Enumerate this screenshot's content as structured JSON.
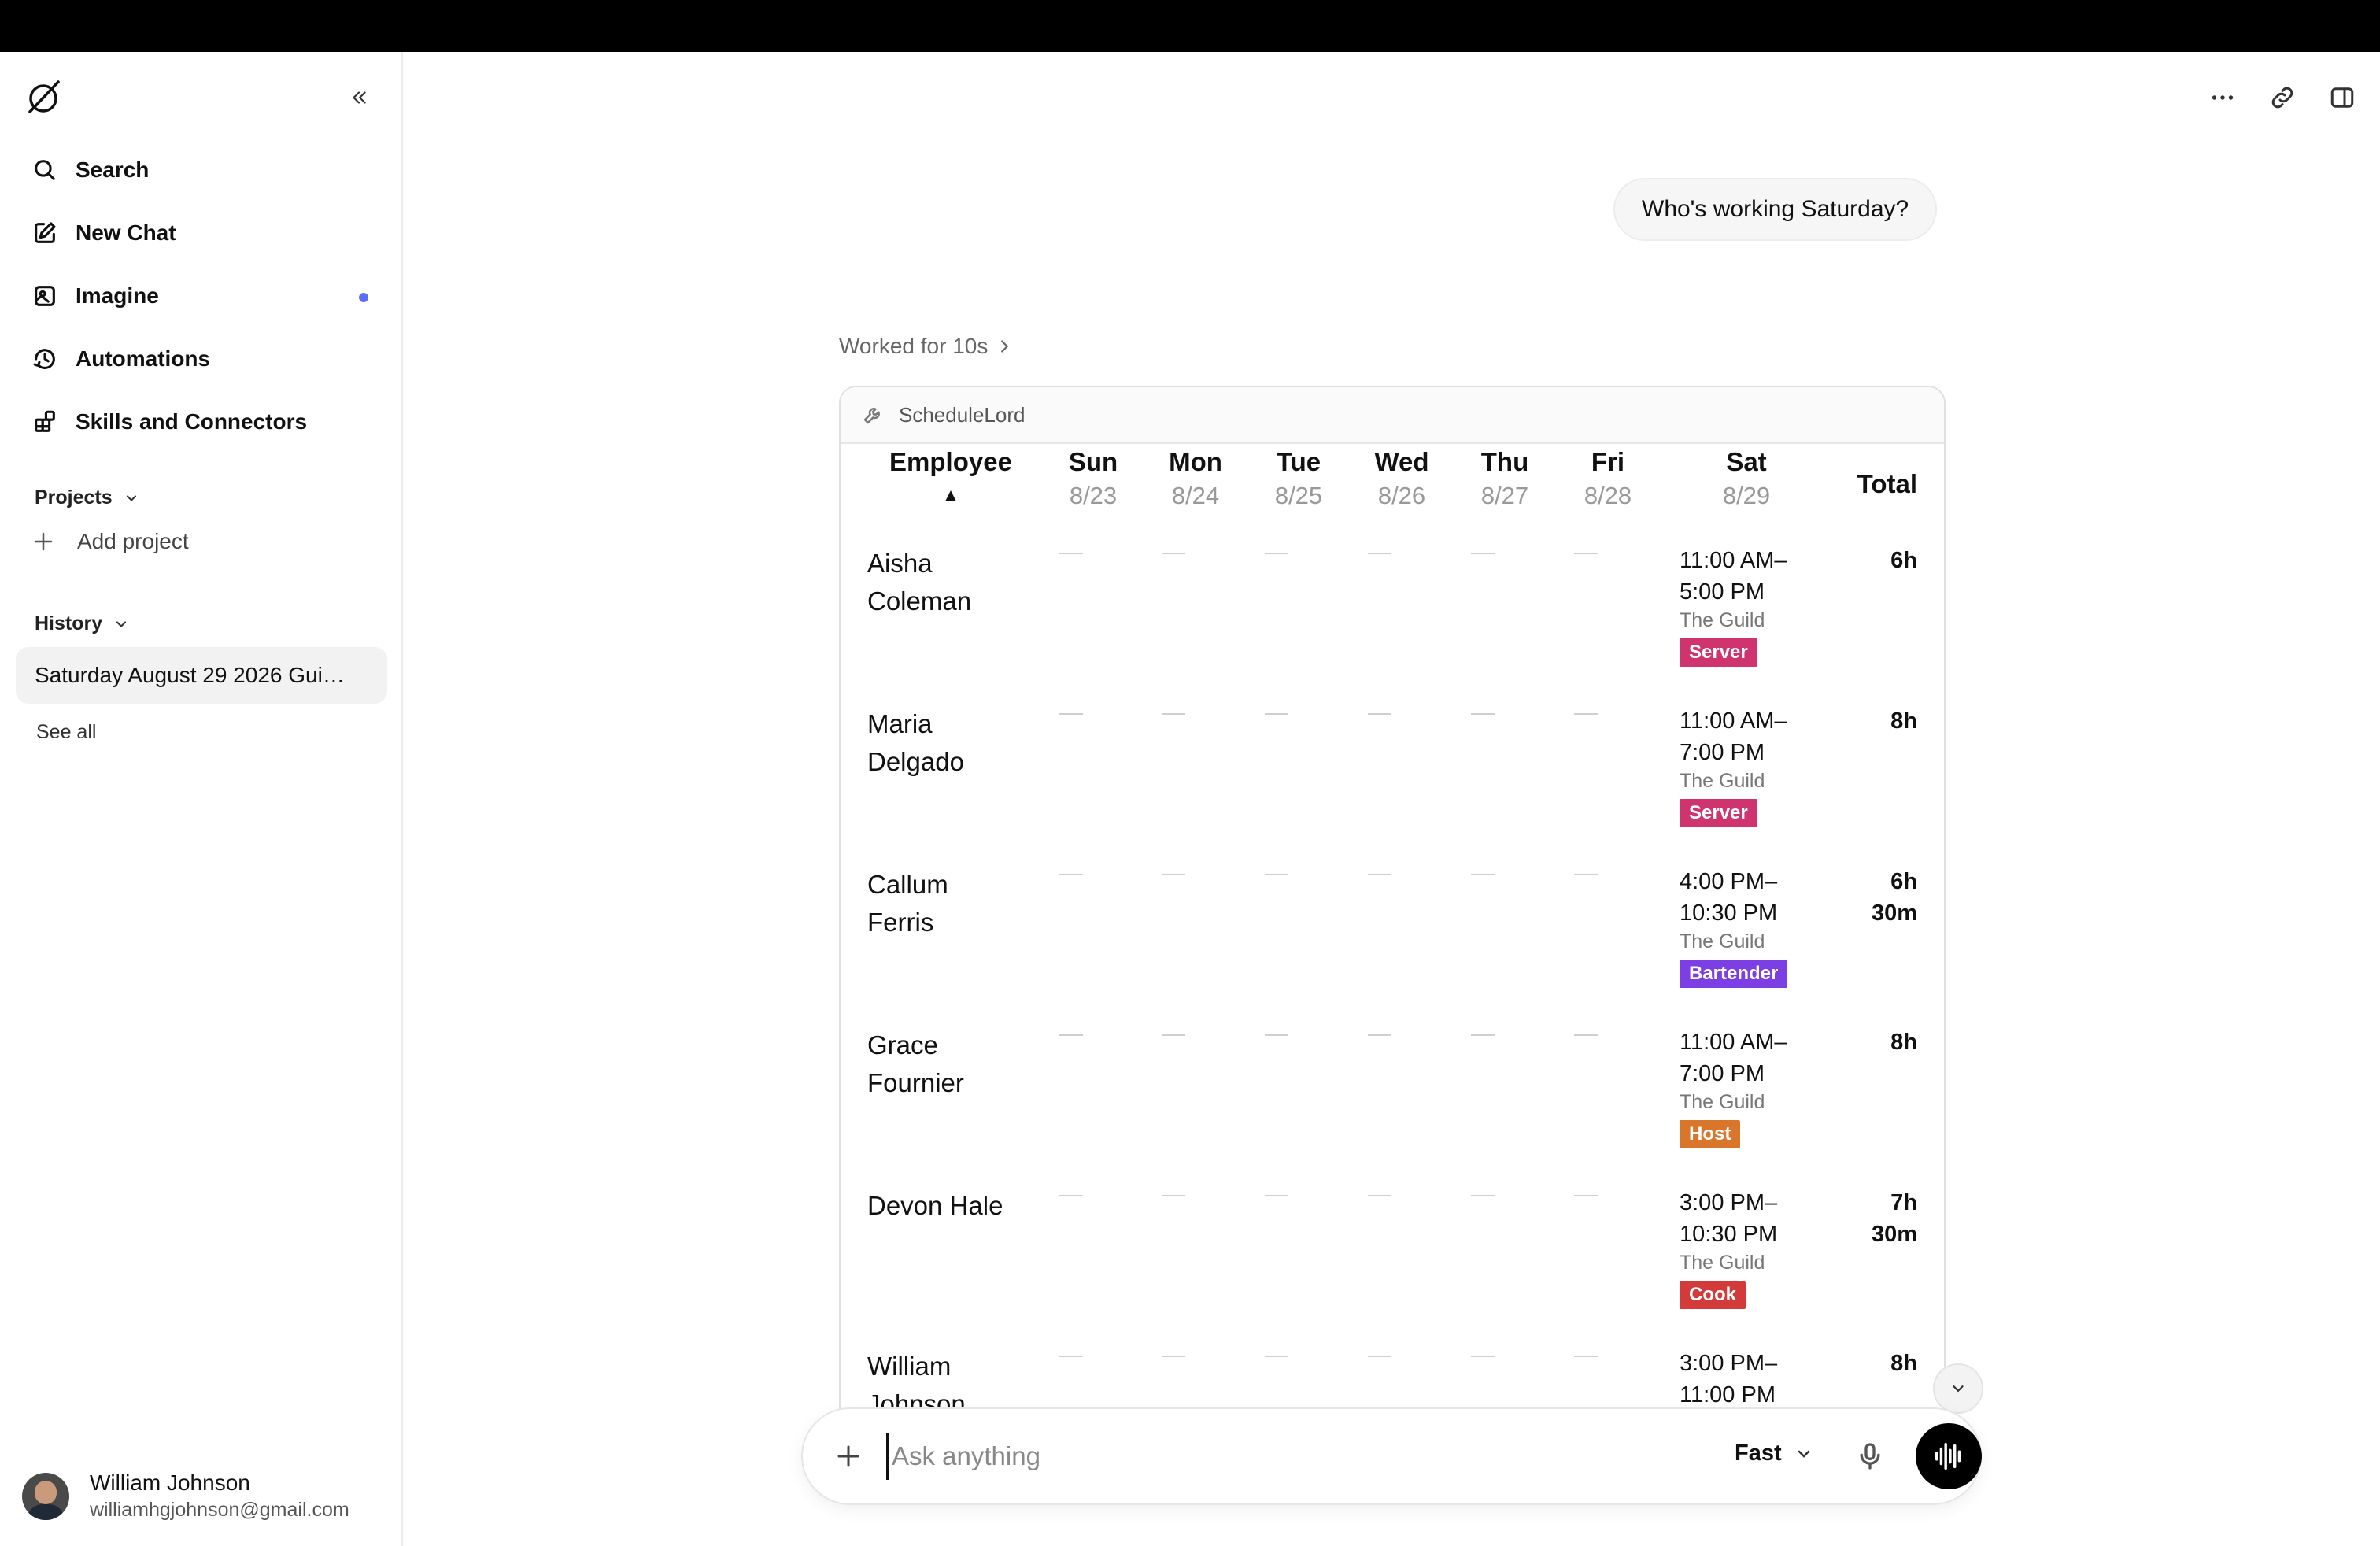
{
  "sidebar": {
    "nav": [
      {
        "label": "Search",
        "icon": "search-icon"
      },
      {
        "label": "New Chat",
        "icon": "new-chat-icon"
      },
      {
        "label": "Imagine",
        "icon": "imagine-icon"
      },
      {
        "label": "Automations",
        "icon": "automations-icon"
      },
      {
        "label": "Skills and Connectors",
        "icon": "skills-icon"
      }
    ],
    "projects_title": "Projects",
    "add_project": "Add project",
    "history_title": "History",
    "history_items": [
      "Saturday August 29 2026 Gui…"
    ],
    "see_all": "See all",
    "user": {
      "name": "William Johnson",
      "email": "williamhgjohnson@gmail.com"
    }
  },
  "chat": {
    "user_message": "Who's working Saturday?",
    "worked_label": "Worked for 10s",
    "tool_name": "ScheduleLord"
  },
  "schedule": {
    "employee_header": "Employee",
    "sort_indicator": "▲",
    "total_header": "Total",
    "days": [
      {
        "day": "Sun",
        "date": "8/23"
      },
      {
        "day": "Mon",
        "date": "8/24"
      },
      {
        "day": "Tue",
        "date": "8/25"
      },
      {
        "day": "Wed",
        "date": "8/26"
      },
      {
        "day": "Thu",
        "date": "8/27"
      },
      {
        "day": "Fri",
        "date": "8/28"
      },
      {
        "day": "Sat",
        "date": "8/29"
      }
    ],
    "rows": [
      {
        "first": "Aisha",
        "last": "Coleman",
        "time1": "11:00 AM–",
        "time2": "5:00 PM",
        "location": "The Guild",
        "role": "Server",
        "role_color": "#d0346f",
        "total1": "6h",
        "total2": ""
      },
      {
        "first": "Maria",
        "last": "Delgado",
        "time1": "11:00 AM–",
        "time2": "7:00 PM",
        "location": "The Guild",
        "role": "Server",
        "role_color": "#d0346f",
        "total1": "8h",
        "total2": ""
      },
      {
        "first": "Callum",
        "last": "Ferris",
        "time1": "4:00 PM–",
        "time2": "10:30 PM",
        "location": "The Guild",
        "role": "Bartender",
        "role_color": "#7b3fe4",
        "total1": "6h",
        "total2": "30m"
      },
      {
        "first": "Grace",
        "last": "Fournier",
        "time1": "11:00 AM–",
        "time2": "7:00 PM",
        "location": "The Guild",
        "role": "Host",
        "role_color": "#d8772b",
        "total1": "8h",
        "total2": ""
      },
      {
        "first": "Devon Hale",
        "last": "",
        "time1": "3:00 PM–",
        "time2": "10:30 PM",
        "location": "The Guild",
        "role": "Cook",
        "role_color": "#d33a3a",
        "total1": "7h",
        "total2": "30m"
      },
      {
        "first": "William",
        "last": "Johnson",
        "time1": "3:00 PM–",
        "time2": "11:00 PM",
        "location": "",
        "role": "",
        "role_color": "",
        "total1": "8h",
        "total2": ""
      }
    ]
  },
  "composer": {
    "placeholder": "Ask anything",
    "mode": "Fast"
  }
}
